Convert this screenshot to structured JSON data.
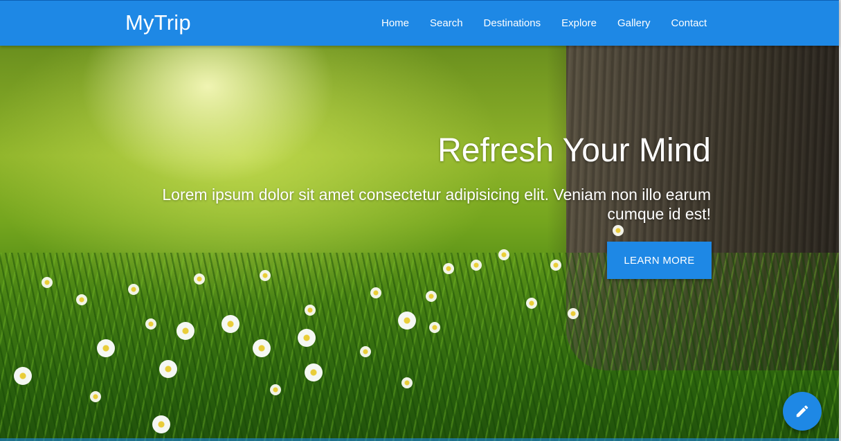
{
  "navbar": {
    "brand": "MyTrip",
    "links": [
      "Home",
      "Search",
      "Destinations",
      "Explore",
      "Gallery",
      "Contact"
    ]
  },
  "hero": {
    "title": "Refresh Your Mind",
    "text": "Lorem ipsum dolor sit amet consectetur adipisicing elit. Veniam non illo earum cumque id est!",
    "button_label": "LEARN MORE"
  },
  "fab": {
    "icon": "pencil-icon"
  },
  "colors": {
    "primary": "#1e88e5",
    "text_light": "#ffffff"
  }
}
